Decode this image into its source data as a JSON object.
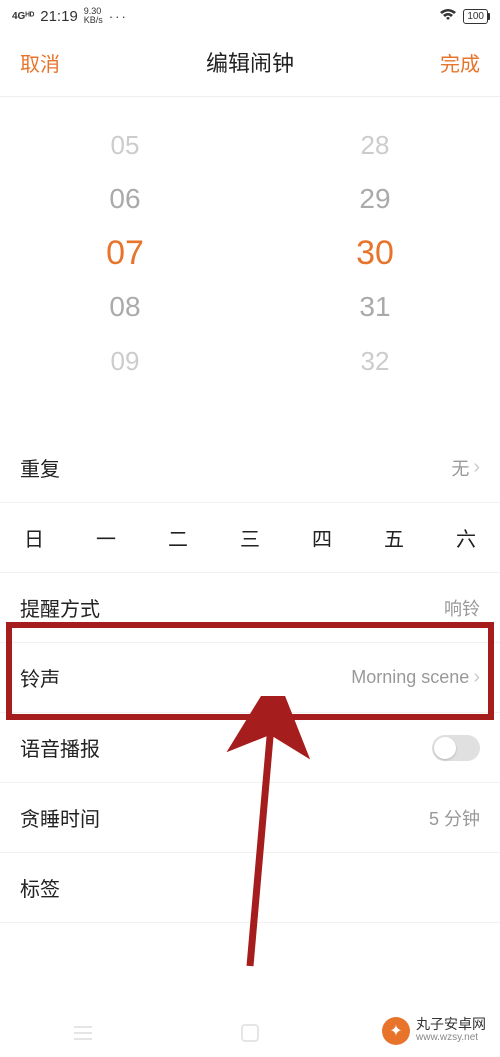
{
  "status": {
    "network": "4Gᴴᴰ",
    "time": "21:19",
    "speed_top": "9.30",
    "speed_bot": "KB/s",
    "dots": "···",
    "battery": "100"
  },
  "header": {
    "cancel": "取消",
    "title": "编辑闹钟",
    "done": "完成"
  },
  "picker": {
    "hours": [
      "05",
      "06",
      "07",
      "08",
      "09"
    ],
    "minutes": [
      "28",
      "29",
      "30",
      "31",
      "32"
    ],
    "selected_hour_index": 2,
    "selected_minute_index": 2
  },
  "week": [
    "日",
    "一",
    "二",
    "三",
    "四",
    "五",
    "六"
  ],
  "rows": {
    "repeat": {
      "label": "重复",
      "value": "无"
    },
    "reminder": {
      "label": "提醒方式",
      "value": "响铃"
    },
    "ringtone": {
      "label": "铃声",
      "value": "Morning scene"
    },
    "voice": {
      "label": "语音播报"
    },
    "snooze": {
      "label": "贪睡时间",
      "value": "5 分钟"
    },
    "tag": {
      "label": "标签"
    }
  },
  "watermark": {
    "title": "丸子安卓网",
    "url": "www.wzsy.net"
  }
}
